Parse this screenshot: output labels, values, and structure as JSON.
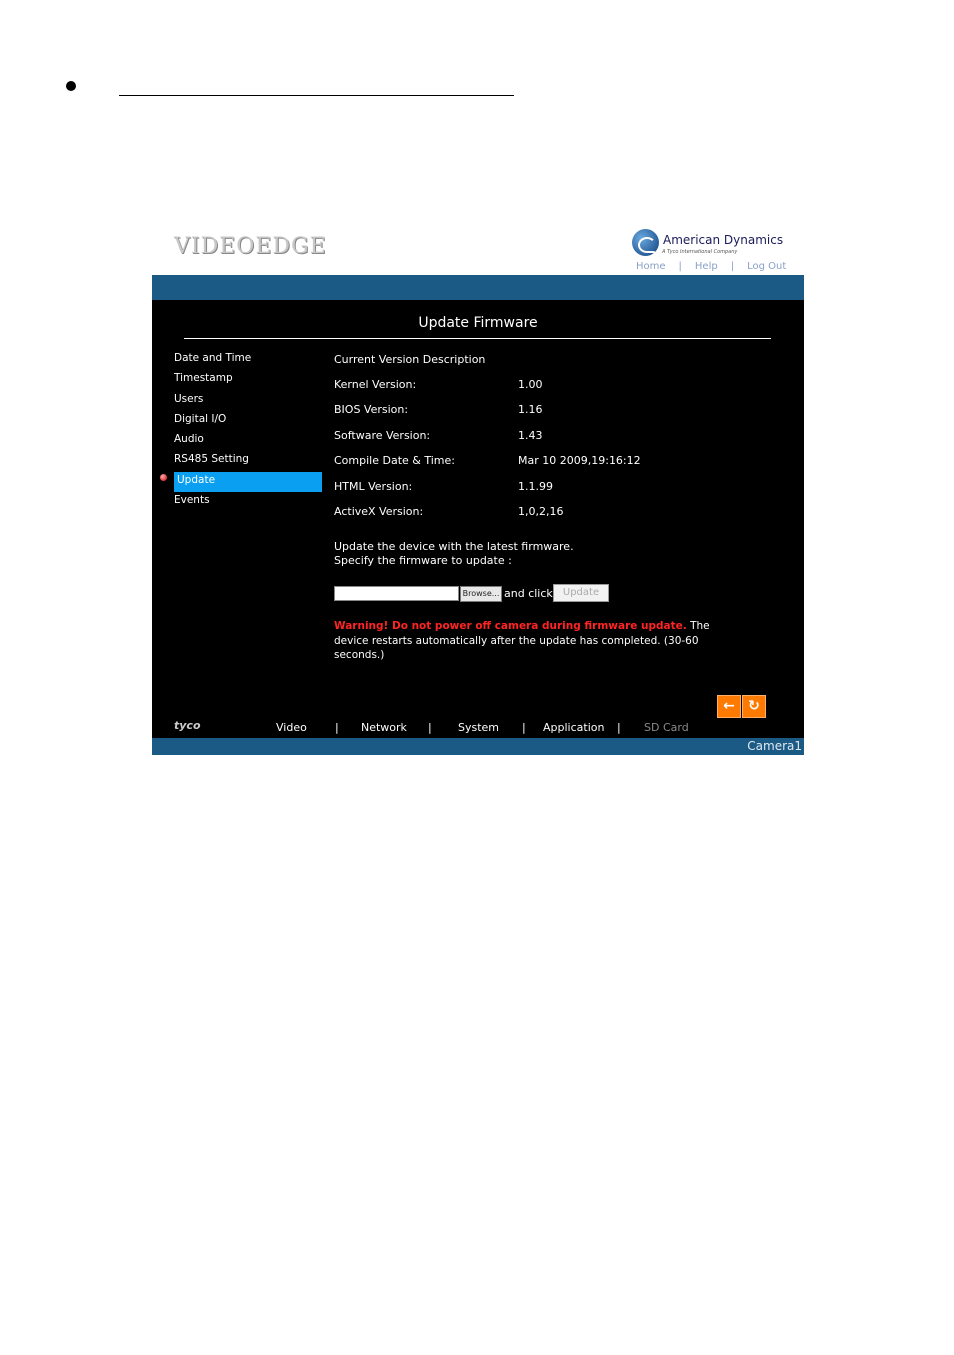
{
  "document": {},
  "header": {
    "logo_text": "VIDEOEDGE",
    "brand_title": "American Dynamics",
    "brand_subtitle": "A Tyco International Company",
    "links": [
      "Home",
      "Help",
      "Log Out"
    ]
  },
  "page_title": "Update Firmware",
  "sidebar": {
    "items": [
      {
        "label": "Date and Time",
        "active": false
      },
      {
        "label": "Timestamp",
        "active": false
      },
      {
        "label": "Users",
        "active": false
      },
      {
        "label": "Digital I/O",
        "active": false
      },
      {
        "label": "Audio",
        "active": false
      },
      {
        "label": "RS485 Setting",
        "active": false
      },
      {
        "label": "Update",
        "active": true
      },
      {
        "label": "Events",
        "active": false
      }
    ]
  },
  "version": {
    "heading": "Current Version Description",
    "rows": [
      {
        "label": "Kernel Version:",
        "value": "1.00"
      },
      {
        "label": "BIOS Version:",
        "value": "1.16"
      },
      {
        "label": "Software Version:",
        "value": "1.43"
      },
      {
        "label": "Compile Date & Time:",
        "value": "Mar 10 2009,19:16:12"
      },
      {
        "label": "HTML Version:",
        "value": "1.1.99"
      },
      {
        "label": "ActiveX Version:",
        "value": "1,0,2,16"
      }
    ]
  },
  "update": {
    "instruction_1": "Update the device with the latest firmware.",
    "instruction_2": "Specify the firmware to update :",
    "file_value": "",
    "browse_label": "Browse...",
    "and_click": "and click",
    "update_label": "Update",
    "warning_red": "Warning! Do not power off camera during firmware update.",
    "warning_rest": " The device restarts automatically after the update has completed. (30-60 seconds.)"
  },
  "footer": {
    "tyco": "tyco",
    "nav": [
      "Video",
      "Network",
      "System",
      "Application",
      "SD Card"
    ],
    "separator": "|",
    "camera": "Camera1",
    "back_icon": "arrow-left-icon",
    "refresh_icon": "refresh-icon"
  }
}
